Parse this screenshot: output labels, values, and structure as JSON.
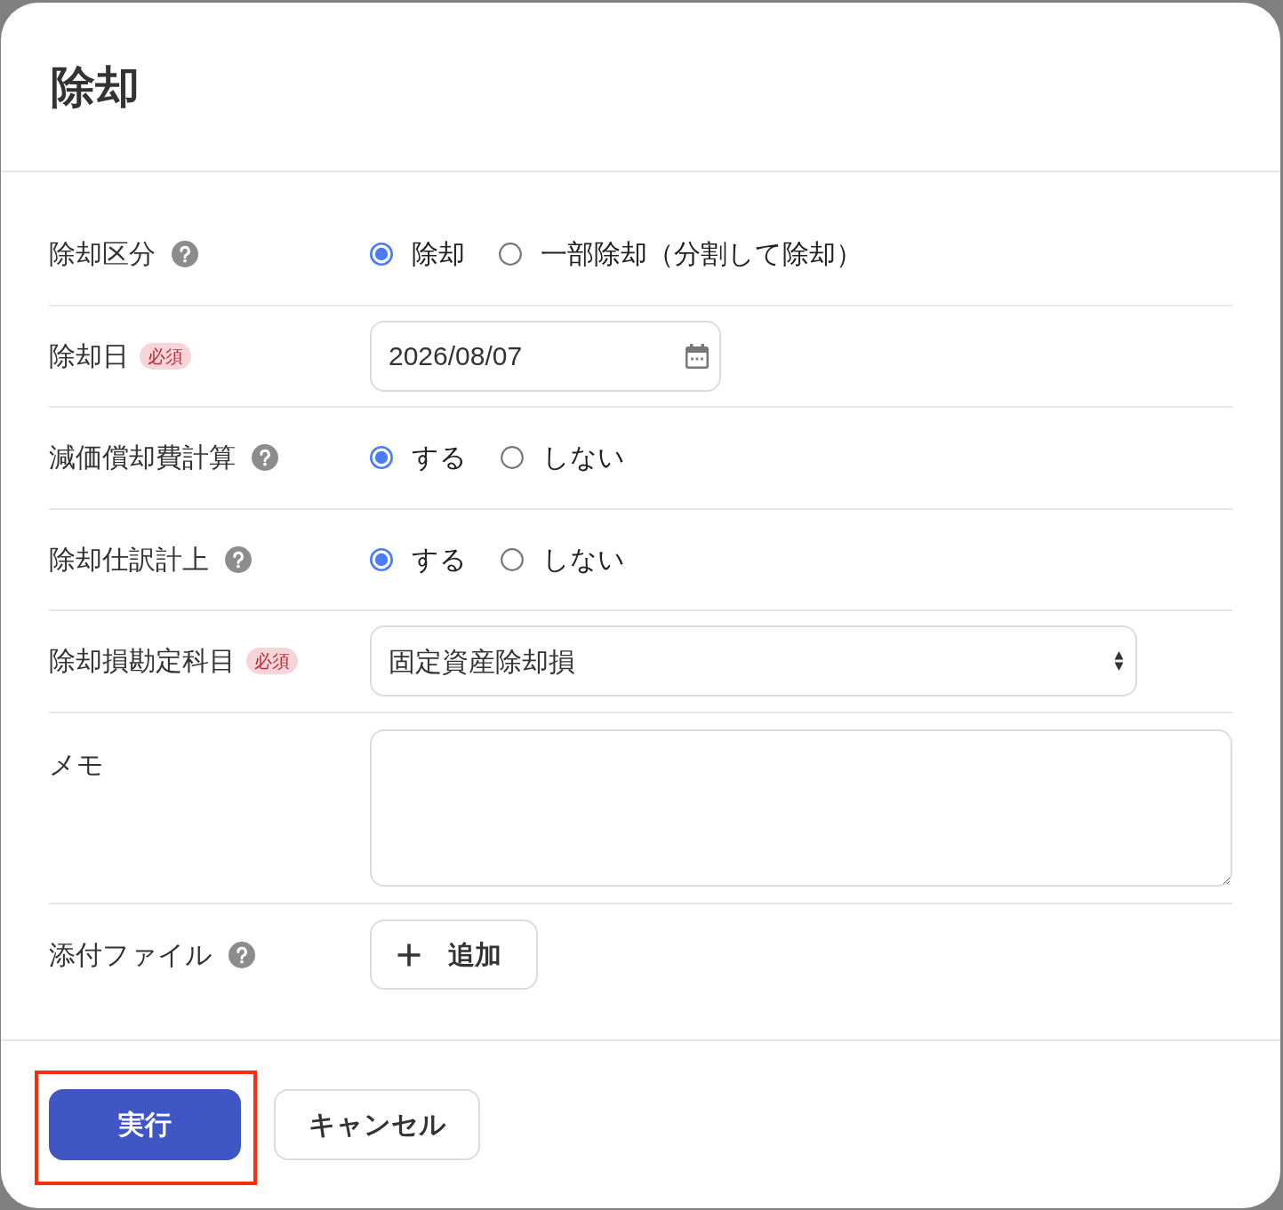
{
  "dialog": {
    "title": "除却"
  },
  "fields": [
    {
      "kind": "radio",
      "label": "除却区分",
      "help": true,
      "options": [
        {
          "label": "除却",
          "selected": true
        },
        {
          "label": "一部除却（分割して除却）",
          "selected": false
        }
      ]
    },
    {
      "kind": "date",
      "label": "除却日",
      "help": false,
      "badge": "必須",
      "value": "2026/08/07"
    },
    {
      "kind": "radio",
      "label": "減価償却費計算",
      "help": true,
      "options": [
        {
          "label": "する",
          "selected": true
        },
        {
          "label": "しない",
          "selected": false
        }
      ]
    },
    {
      "kind": "radio",
      "label": "除却仕訳計上",
      "help": true,
      "options": [
        {
          "label": "する",
          "selected": true
        },
        {
          "label": "しない",
          "selected": false
        }
      ]
    },
    {
      "kind": "select",
      "label": "除却損勘定科目",
      "help": false,
      "badge": "必須",
      "value": "固定資産除却損"
    },
    {
      "kind": "textarea",
      "label": "メモ",
      "help": false
    },
    {
      "kind": "file",
      "label": "添付ファイル",
      "help": true,
      "button": "追加"
    }
  ],
  "buttons": [
    {
      "kind": "submit",
      "label": "実行",
      "highlighted": true
    },
    {
      "kind": "cancel",
      "label": "キャンセル",
      "highlighted": false
    }
  ]
}
